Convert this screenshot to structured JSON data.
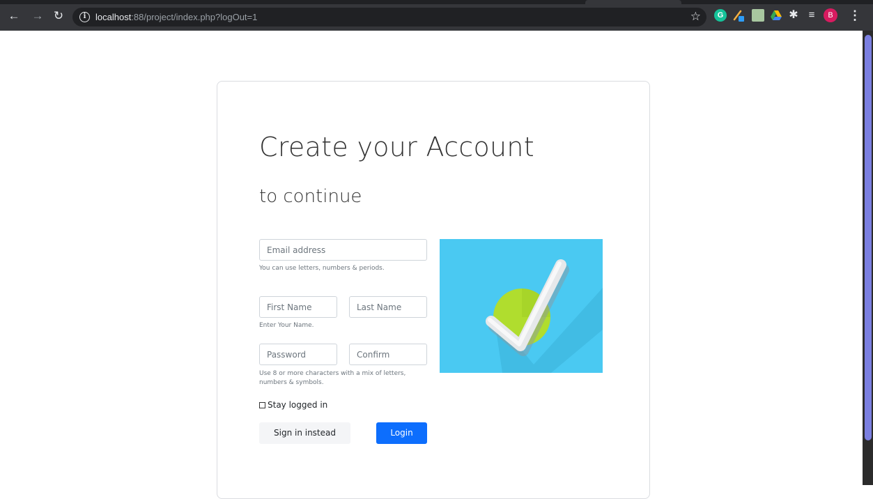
{
  "browser": {
    "url_host": "localhost",
    "url_rest": ":88/project/index.php?logOut=1",
    "profile_initial": "B",
    "icons": {
      "back": "arrow-left-icon",
      "forward": "arrow-right-icon",
      "reload": "reload-icon",
      "info": "info-icon",
      "bookmark": "star-icon",
      "grammarly": "grammarly-icon",
      "pen": "pen-extension-icon",
      "box": "extension-box-icon",
      "drive": "google-drive-icon",
      "extensions": "puzzle-icon",
      "reading_list": "reading-list-icon",
      "menu": "kebab-menu-icon"
    },
    "grammarly_letter": "G"
  },
  "form": {
    "title": "Create your Account",
    "subtitle": "to continue",
    "email_placeholder": "Email address",
    "email_help": "You can use letters, numbers & periods.",
    "first_name_placeholder": "First Name",
    "last_name_placeholder": "Last Name",
    "name_help": "Enter Your Name.",
    "password_placeholder": "Password",
    "confirm_placeholder": "Confirm",
    "password_help": "Use 8 or more characters with a mix of letters, numbers & symbols.",
    "stay_logged_in": "Stay logged in",
    "secondary_button": "Sign in instead",
    "primary_button": "Login"
  },
  "colors": {
    "primary": "#0d6efd",
    "illustration_bg": "#4ac9f2",
    "illustration_circle": "#b0dd2e",
    "avatar": "#d81b60"
  }
}
